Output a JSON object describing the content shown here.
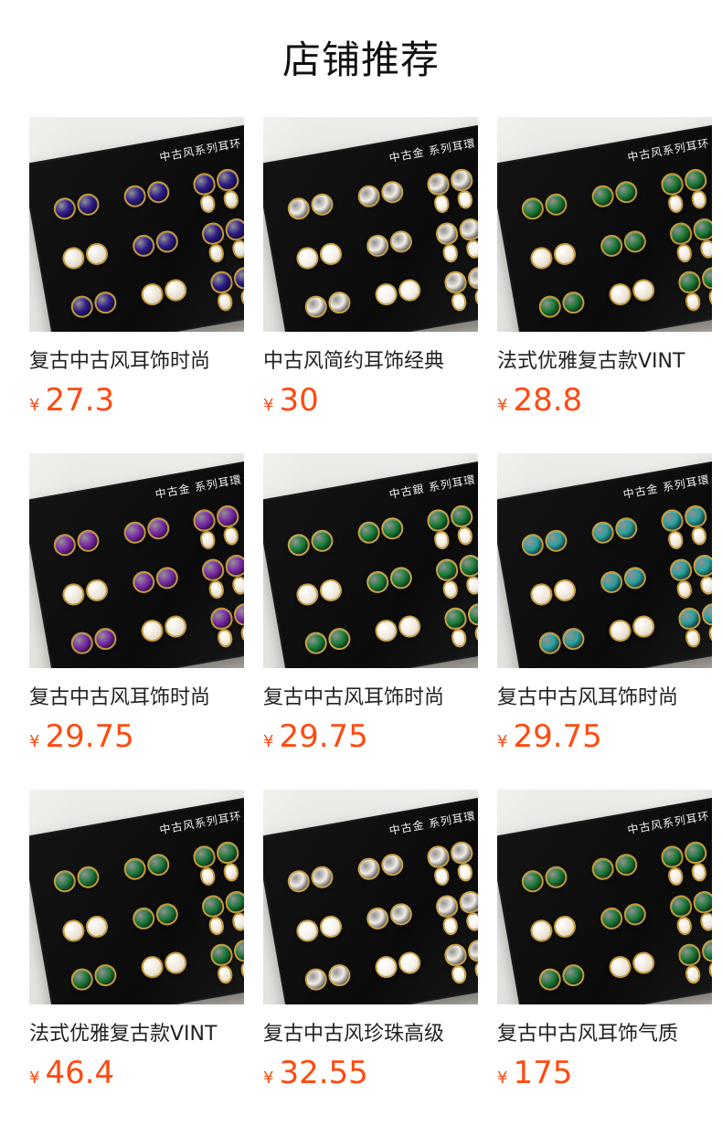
{
  "section": {
    "title": "店铺推荐"
  },
  "products": [
    {
      "name": "复古中古风耳饰时尚",
      "price_currency": "¥",
      "price": "27.3",
      "tray_label": "中古风系列耳环",
      "palette": {
        "accent": "#2d1b8a",
        "metal": "#c59b3a",
        "pearl": "#e9e3d6"
      }
    },
    {
      "name": "中古风简约耳饰经典",
      "price_currency": "¥",
      "price": "30",
      "tray_label": "中古金 系列耳環",
      "palette": {
        "accent": "#f1ede6",
        "metal": "#c9a347",
        "pearl": "#f5f1ea"
      }
    },
    {
      "name": "法式优雅复古款VINT",
      "price_currency": "¥",
      "price": "28.8",
      "tray_label": "中古风系列耳环",
      "palette": {
        "accent": "#1b7a36",
        "metal": "#c49a3a",
        "pearl": "#efe7d8"
      }
    },
    {
      "name": "复古中古风耳饰时尚",
      "price_currency": "¥",
      "price": "29.75",
      "tray_label": "中古金 系列耳環",
      "palette": {
        "accent": "#7a2aa8",
        "metal": "#c49a3a",
        "pearl": "#eee6d8"
      }
    },
    {
      "name": "复古中古风耳饰时尚",
      "price_currency": "¥",
      "price": "29.75",
      "tray_label": "中古銀 系列耳環",
      "palette": {
        "accent": "#1a7f3b",
        "metal": "#c9a24a",
        "pearl": "#f1ebe0"
      }
    },
    {
      "name": "复古中古风耳饰时尚",
      "price_currency": "¥",
      "price": "29.75",
      "tray_label": "中古金 系列耳環",
      "palette": {
        "accent": "#2aa0a0",
        "metal": "#c59c3d",
        "pearl": "#efe6d7"
      }
    },
    {
      "name": "法式优雅复古款VINT",
      "price_currency": "¥",
      "price": "46.4",
      "tray_label": "中古风系列耳环",
      "palette": {
        "accent": "#1f7a3e",
        "metal": "#c59b3a",
        "pearl": "#efe7d8"
      }
    },
    {
      "name": "复古中古风珍珠高级",
      "price_currency": "¥",
      "price": "32.55",
      "tray_label": "中古金 系列耳環",
      "palette": {
        "accent": "#f0ece6",
        "metal": "#c9a24a",
        "pearl": "#f7f3ec"
      }
    },
    {
      "name": "复古中古风耳饰气质",
      "price_currency": "¥",
      "price": "175",
      "tray_label": "中古风系列耳环",
      "palette": {
        "accent": "#1d7b3a",
        "metal": "#c49a3a",
        "pearl": "#efe7d8"
      }
    }
  ]
}
